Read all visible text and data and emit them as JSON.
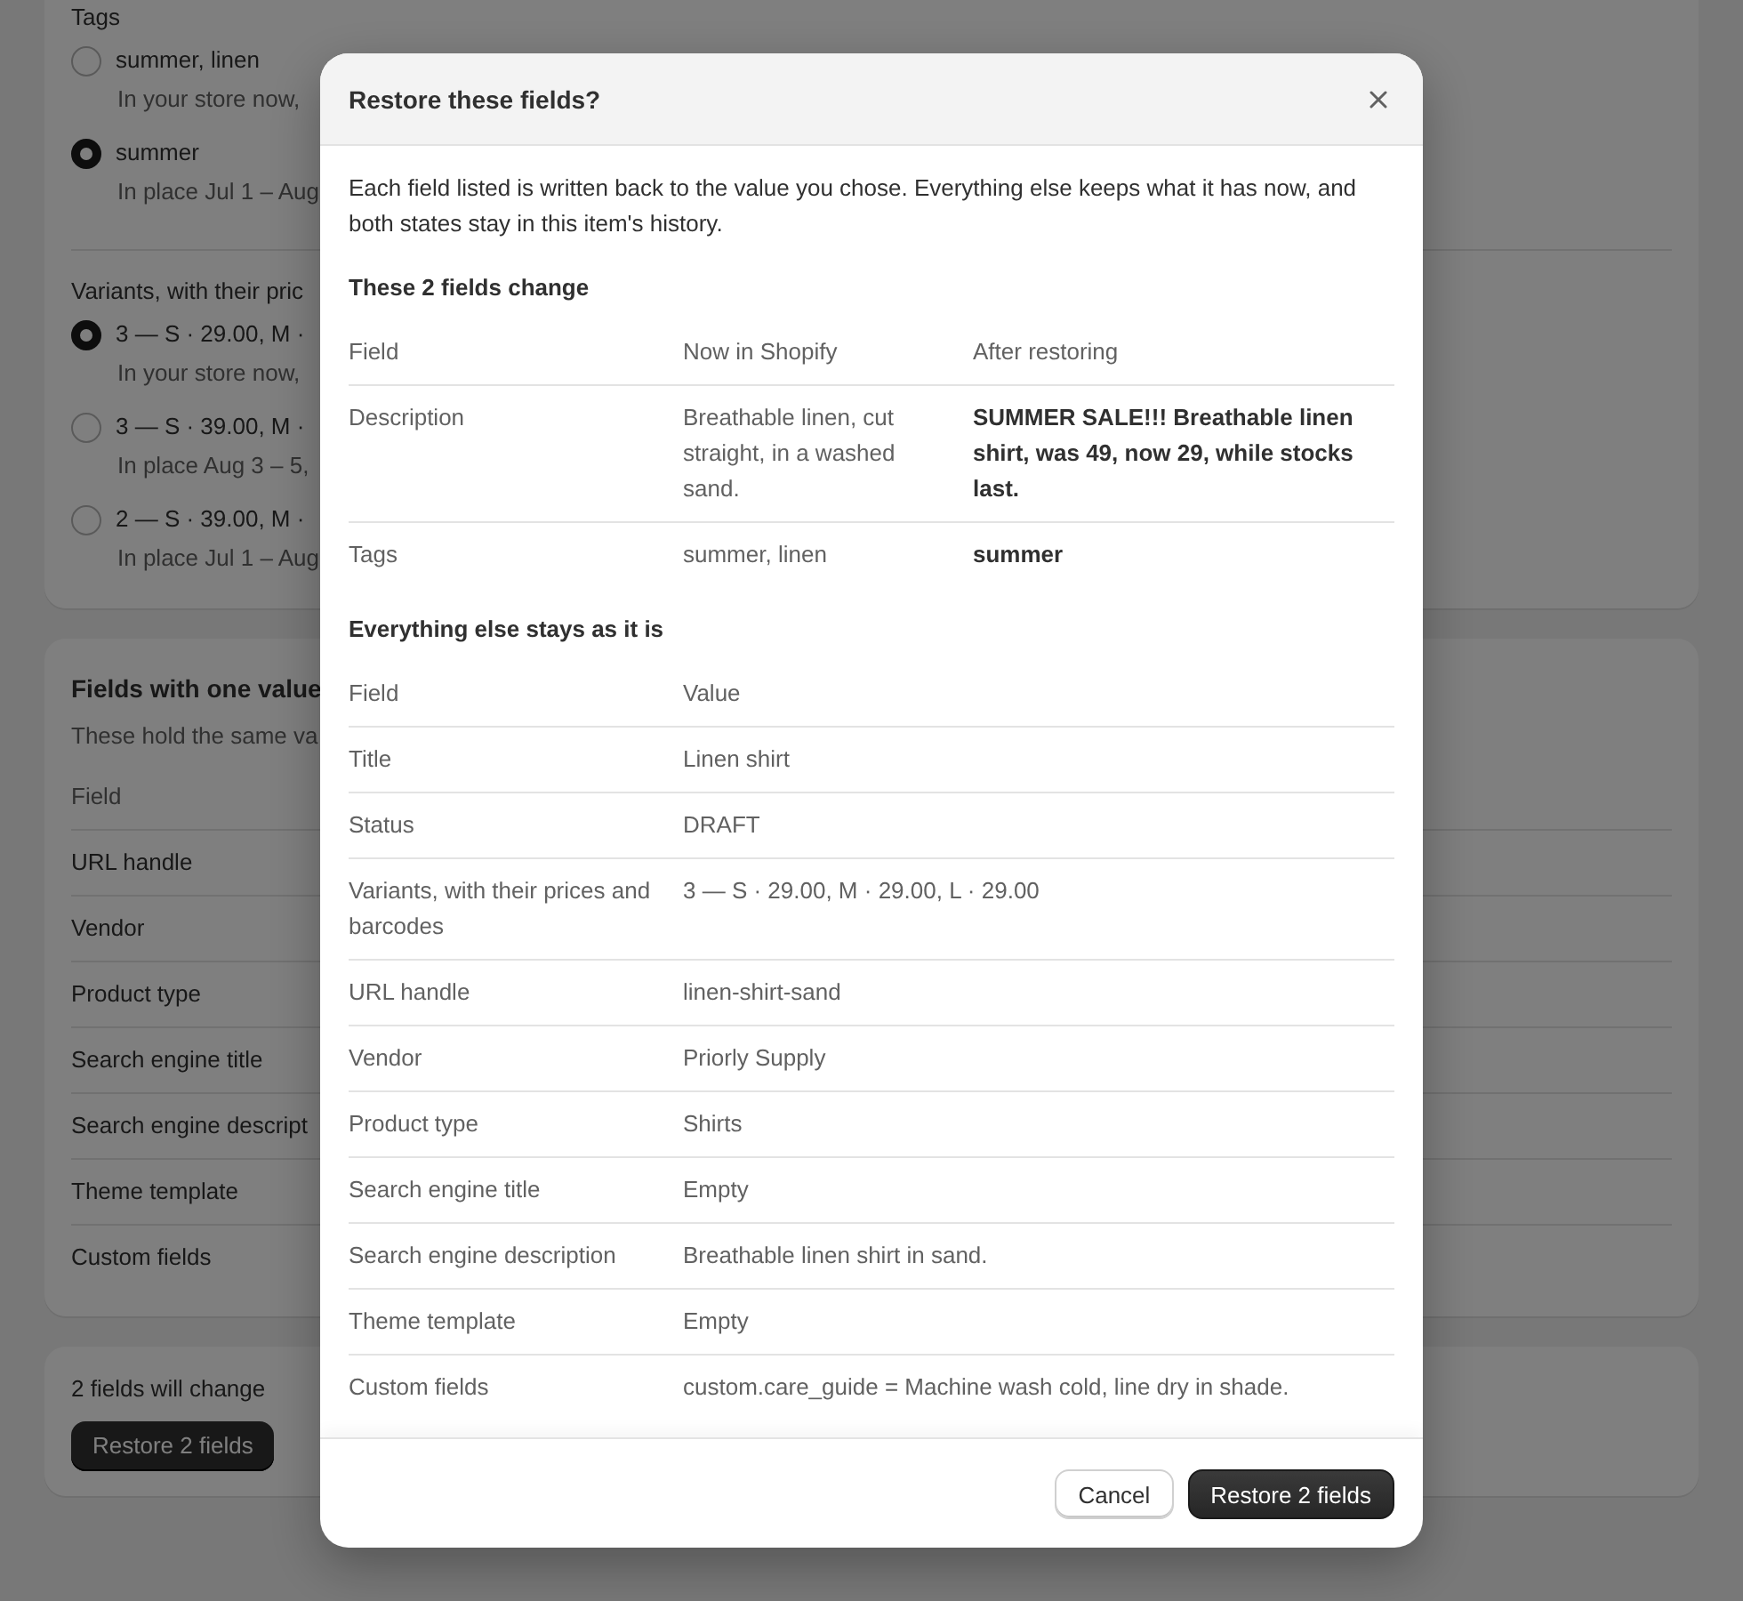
{
  "background": {
    "tags_group": {
      "label": "Tags",
      "options": [
        {
          "label": "summer, linen",
          "note": "In your store now,",
          "selected": false
        },
        {
          "label": "summer",
          "note": "In place Jul 1 – Aug",
          "selected": true
        }
      ]
    },
    "variants_group": {
      "label": "Variants, with their pric",
      "options": [
        {
          "label": "3 — S · 29.00, M ·",
          "note": "In your store now,",
          "selected": true
        },
        {
          "label": "3 — S · 39.00, M ·",
          "note": "In place Aug 3 – 5,",
          "selected": false
        },
        {
          "label": "2 — S · 39.00, M ·",
          "note": "In place Jul 1 – Aug",
          "selected": false
        }
      ]
    },
    "single_value_card": {
      "title": "Fields with one value",
      "subtitle": "These hold the same va",
      "columns": [
        "Field"
      ],
      "rows": [
        "URL handle",
        "Vendor",
        "Product type",
        "Search engine title",
        "Search engine descript",
        "Theme template",
        "Custom fields"
      ]
    },
    "footer_card": {
      "summary": "2 fields will change",
      "button": "Restore 2 fields"
    }
  },
  "dialog": {
    "title": "Restore these fields?",
    "intro": "Each field listed is written back to the value you chose. Everything else keeps what it has now, and both states stay in this item's history.",
    "changes": {
      "heading": "These 2 fields change",
      "columns": [
        "Field",
        "Now in Shopify",
        "After restoring"
      ],
      "rows": [
        {
          "field": "Description",
          "now": "Breathable linen, cut straight, in a washed sand.",
          "after": "SUMMER SALE!!! Breathable linen shirt, was 49, now 29, while stocks last."
        },
        {
          "field": "Tags",
          "now": "summer, linen",
          "after": "summer"
        }
      ]
    },
    "unchanged": {
      "heading": "Everything else stays as it is",
      "columns": [
        "Field",
        "Value"
      ],
      "rows": [
        {
          "field": "Title",
          "value": "Linen shirt"
        },
        {
          "field": "Status",
          "value": "DRAFT"
        },
        {
          "field": "Variants, with their prices and barcodes",
          "value": "3 — S · 29.00, M · 29.00, L · 29.00"
        },
        {
          "field": "URL handle",
          "value": "linen-shirt-sand"
        },
        {
          "field": "Vendor",
          "value": "Priorly Supply"
        },
        {
          "field": "Product type",
          "value": "Shirts"
        },
        {
          "field": "Search engine title",
          "value": "Empty"
        },
        {
          "field": "Search engine description",
          "value": "Breathable linen shirt in sand."
        },
        {
          "field": "Theme template",
          "value": "Empty"
        },
        {
          "field": "Custom fields",
          "value": "custom.care_guide = Machine wash cold, line dry in shade."
        }
      ]
    },
    "buttons": [
      {
        "label": "Cancel",
        "kind": "secondary"
      },
      {
        "label": "Restore 2 fields",
        "kind": "primary"
      }
    ]
  }
}
